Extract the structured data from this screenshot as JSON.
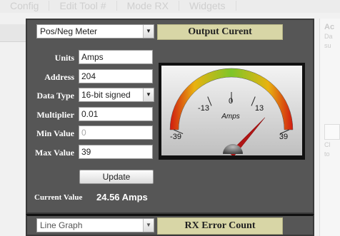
{
  "background_tabs": [
    "Config",
    "Edit Tool #",
    "Mode RX",
    "Widgets"
  ],
  "right_panel": {
    "title": "Ac",
    "desc_line1": "Da",
    "desc_line2": "su",
    "c_line1": "Cl",
    "c_line2": "to"
  },
  "widget": {
    "type_select": "Pos/Neg Meter",
    "title": "Output Curent",
    "fields": {
      "units": {
        "label": "Units",
        "value": "Amps"
      },
      "address": {
        "label": "Address",
        "value": "204"
      },
      "data_type": {
        "label": "Data Type",
        "value": "16-bit signed"
      },
      "multiplier": {
        "label": "Multiplier",
        "value": "0.01"
      },
      "min_value": {
        "label": "Min Value",
        "placeholder": "0"
      },
      "max_value": {
        "label": "Max Value",
        "value": "39"
      }
    },
    "update_label": "Update",
    "current_value_label": "Current Value",
    "current_value": "24.56 Amps",
    "gauge": {
      "min": -39,
      "max": 39,
      "value": 24.56,
      "unit_label": "Amps",
      "tick_labels": [
        "-39",
        "-13",
        "0",
        "13",
        "39"
      ]
    }
  },
  "next_widget": {
    "type_select": "Line Graph",
    "title": "RX Error Count"
  },
  "colors": {
    "panel": "#565656",
    "title_bg": "#d8d6a6",
    "needle": "#b01515"
  }
}
